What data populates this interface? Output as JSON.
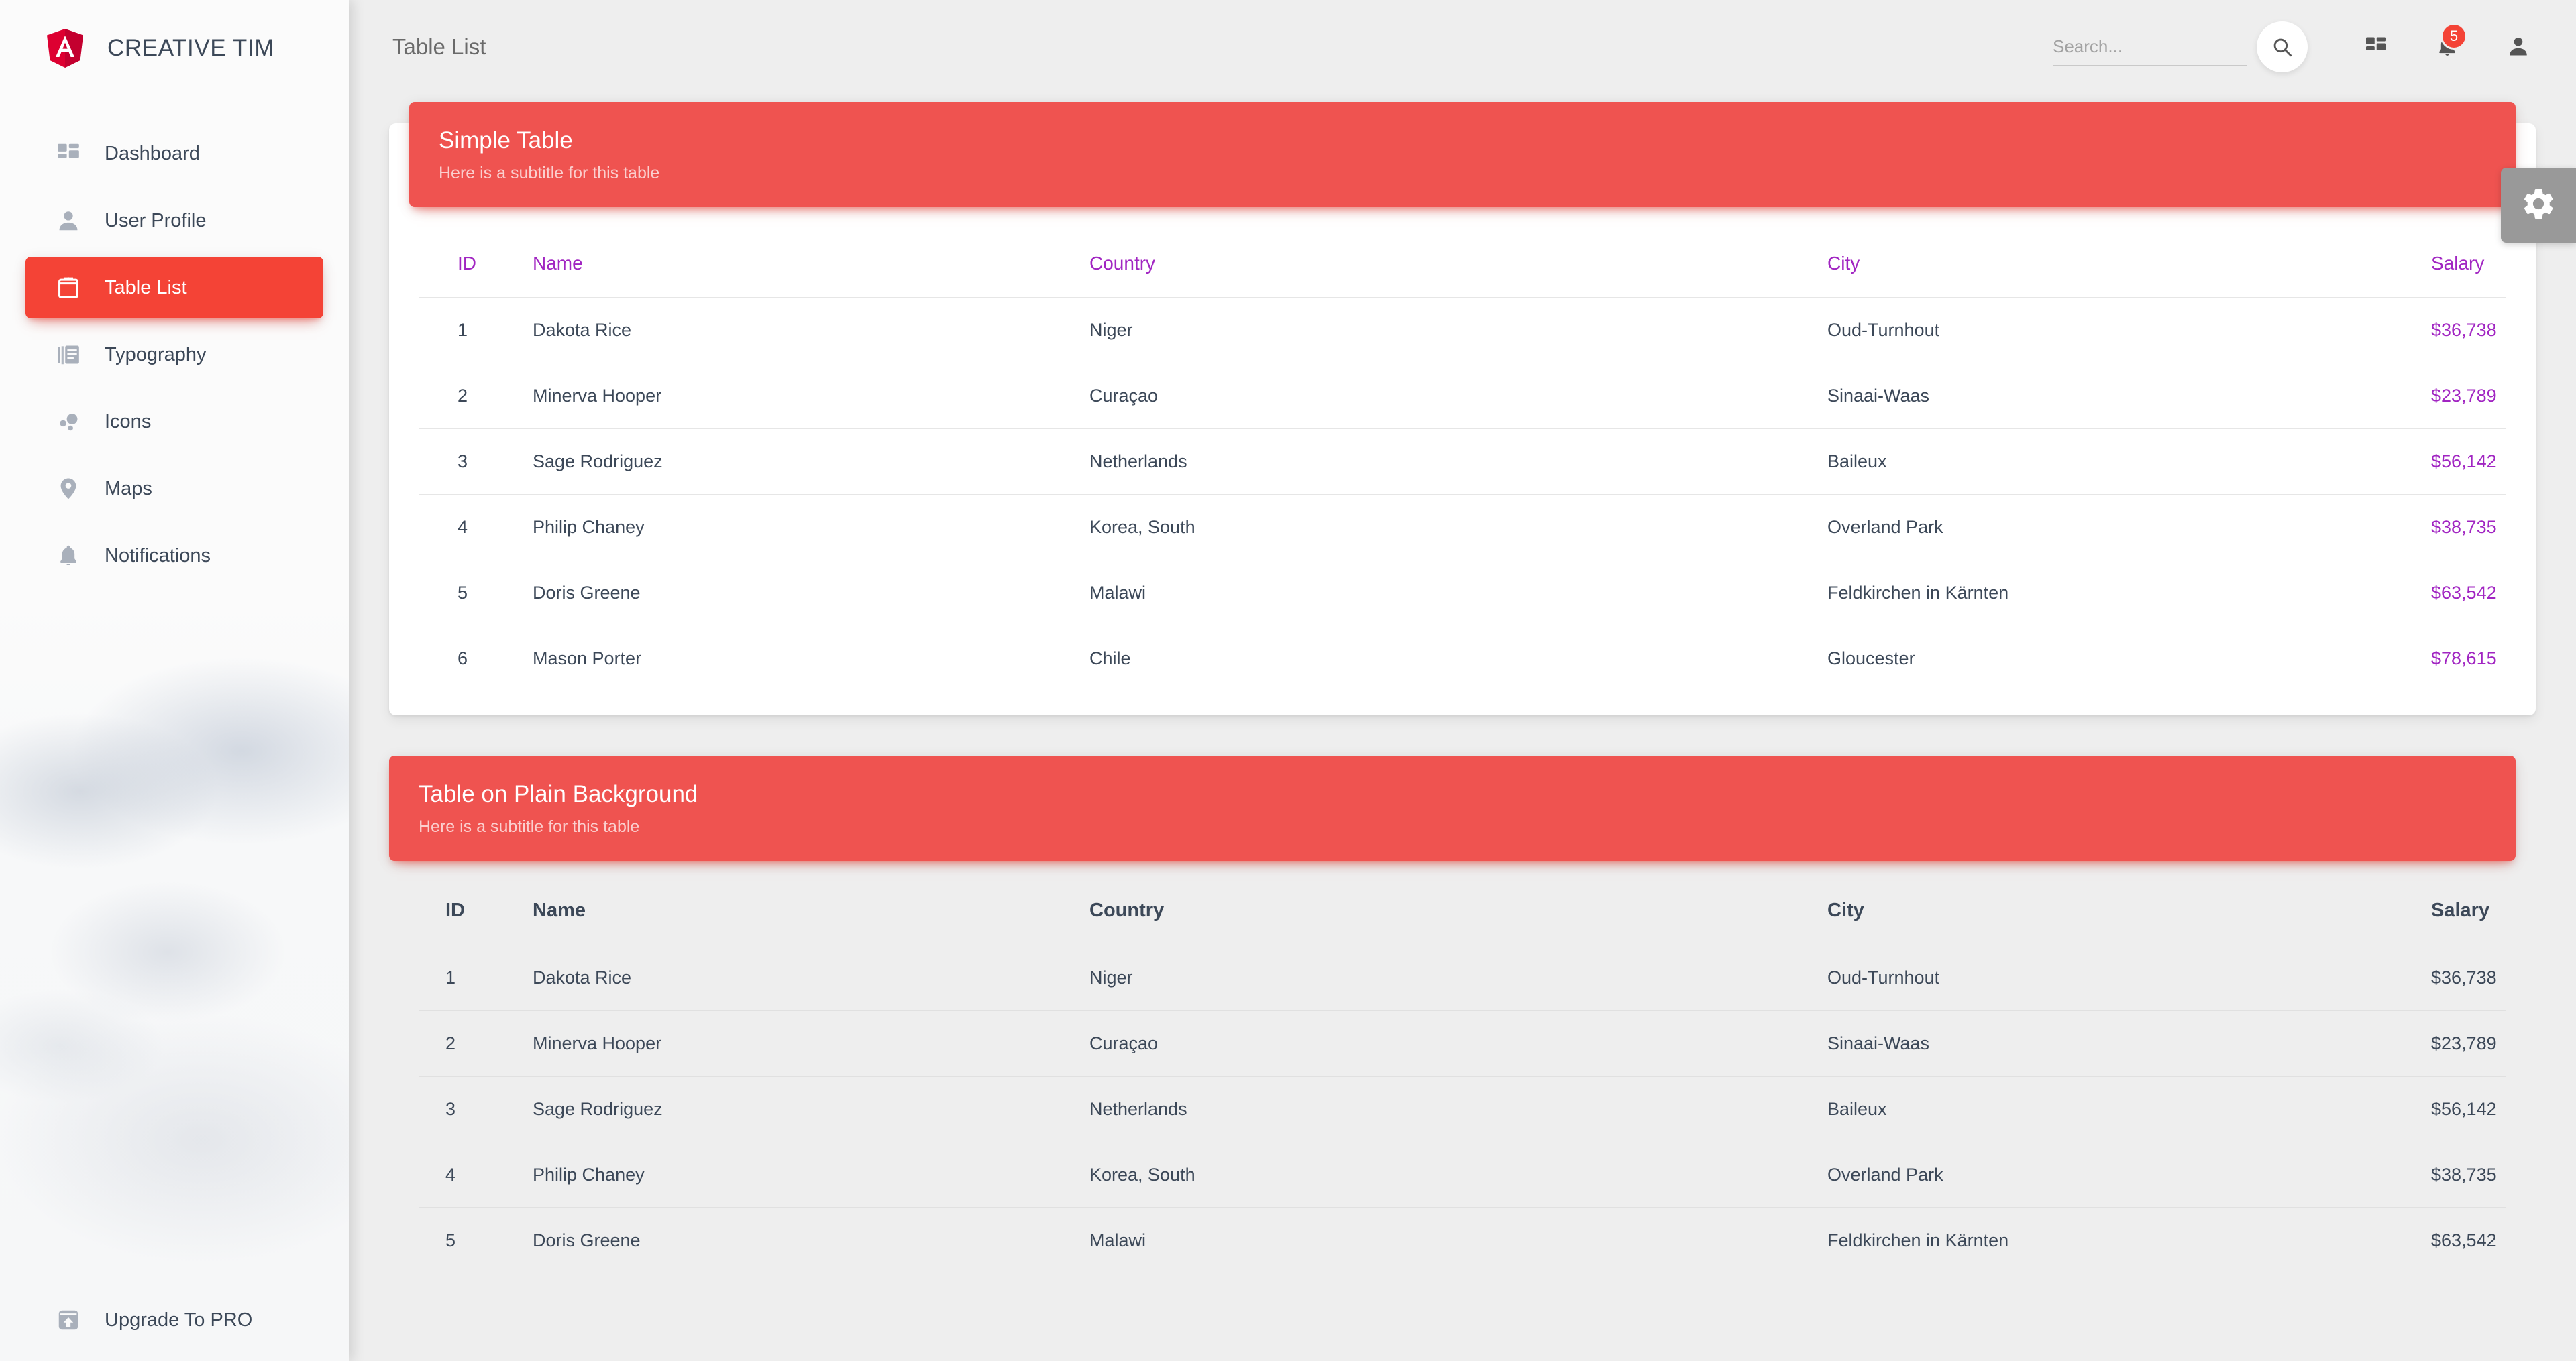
{
  "brand": {
    "name": "CREATIVE TIM",
    "logo_icon": "angular-shield-icon",
    "accent": "#f44336"
  },
  "sidebar": {
    "items": [
      {
        "label": "Dashboard",
        "icon": "dashboard-icon",
        "active": false
      },
      {
        "label": "User Profile",
        "icon": "person-icon",
        "active": false
      },
      {
        "label": "Table List",
        "icon": "clipboard-icon",
        "active": true
      },
      {
        "label": "Typography",
        "icon": "library-books-icon",
        "active": false
      },
      {
        "label": "Icons",
        "icon": "bubble-chart-icon",
        "active": false
      },
      {
        "label": "Maps",
        "icon": "location-pin-icon",
        "active": false
      },
      {
        "label": "Notifications",
        "icon": "bell-icon",
        "active": false
      }
    ],
    "upgrade": {
      "label": "Upgrade To PRO",
      "icon": "unarchive-icon"
    }
  },
  "navbar": {
    "title": "Table List",
    "search": {
      "value": "",
      "placeholder": "Search..."
    },
    "search_button_icon": "search-icon",
    "dashboard_icon": "dashboard-grid-icon",
    "notifications_icon": "bell-icon",
    "notifications_count": "5",
    "profile_icon": "person-icon"
  },
  "settings_tab": {
    "icon": "gear-icon"
  },
  "tables": [
    {
      "title": "Simple Table",
      "subtitle": "Here is a subtitle for this table",
      "style": "card",
      "header_color": "#a125c2",
      "columns": [
        "ID",
        "Name",
        "Country",
        "City",
        "Salary"
      ],
      "rows": [
        [
          "1",
          "Dakota Rice",
          "Niger",
          "Oud-Turnhout",
          "$36,738"
        ],
        [
          "2",
          "Minerva Hooper",
          "Curaçao",
          "Sinaai-Waas",
          "$23,789"
        ],
        [
          "3",
          "Sage Rodriguez",
          "Netherlands",
          "Baileux",
          "$56,142"
        ],
        [
          "4",
          "Philip Chaney",
          "Korea, South",
          "Overland Park",
          "$38,735"
        ],
        [
          "5",
          "Doris Greene",
          "Malawi",
          "Feldkirchen in Kärnten",
          "$63,542"
        ],
        [
          "6",
          "Mason Porter",
          "Chile",
          "Gloucester",
          "$78,615"
        ]
      ]
    },
    {
      "title": "Table on Plain Background",
      "subtitle": "Here is a subtitle for this table",
      "style": "plain",
      "header_color": "#3c4858",
      "columns": [
        "ID",
        "Name",
        "Country",
        "City",
        "Salary"
      ],
      "rows": [
        [
          "1",
          "Dakota Rice",
          "Niger",
          "Oud-Turnhout",
          "$36,738"
        ],
        [
          "2",
          "Minerva Hooper",
          "Curaçao",
          "Sinaai-Waas",
          "$23,789"
        ],
        [
          "3",
          "Sage Rodriguez",
          "Netherlands",
          "Baileux",
          "$56,142"
        ],
        [
          "4",
          "Philip Chaney",
          "Korea, South",
          "Overland Park",
          "$38,735"
        ],
        [
          "5",
          "Doris Greene",
          "Malawi",
          "Feldkirchen in Kärnten",
          "$63,542"
        ]
      ]
    }
  ]
}
